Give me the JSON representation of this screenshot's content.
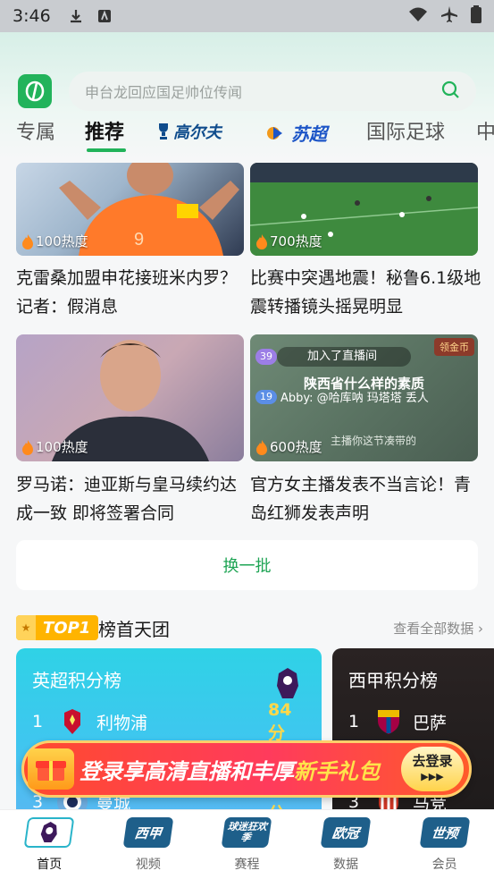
{
  "status_bar": {
    "time": "3:46"
  },
  "header": {
    "search_placeholder": "申台龙回应国足帅位传闻",
    "tabs": [
      {
        "label": "专属"
      },
      {
        "label": "推荐"
      },
      {
        "label": "高尔夫"
      },
      {
        "label": "苏超"
      },
      {
        "label": "国际足球"
      },
      {
        "label": "中"
      }
    ]
  },
  "news": [
    {
      "heat": "100热度",
      "title": "克雷桑加盟申花接班米内罗？记者：假消息"
    },
    {
      "heat": "700热度",
      "title": "比赛中突遇地震！秘鲁6.1级地震转播镜头摇晃明显"
    },
    {
      "heat": "100热度",
      "title": "罗马诺：迪亚斯与皇马续约达成一致 即将签署合同"
    },
    {
      "heat": "600热度",
      "title": "官方女主播发表不当言论！青岛红狮发表声明"
    }
  ],
  "stream_overlay": {
    "tag": "领金币",
    "join_text": "加入了直播间",
    "headline": "陕西省什么样的素质",
    "chat_user": "Abby: @哈库呐 玛塔塔 丢人",
    "chat_line": "主播你这节凑带的",
    "badge_level_1": "39",
    "badge_level_2": "19"
  },
  "refresh_label": "换一批",
  "rank": {
    "badge": "TOP1",
    "title": "榜首天团",
    "see_all": "查看全部数据",
    "boards": [
      {
        "title": "英超积分榜",
        "rows": [
          {
            "no": "1",
            "team": "利物浦",
            "pts": "84分"
          },
          {
            "no": "3",
            "team": "曼城",
            "pts": "71分"
          }
        ]
      },
      {
        "title": "西甲积分榜",
        "rows": [
          {
            "no": "1",
            "team": "巴萨"
          },
          {
            "no": "3",
            "team": "马竞"
          }
        ]
      }
    ]
  },
  "promo": {
    "text_a": "登录享高清直播和丰厚",
    "text_b": "新手礼包",
    "button_line1": "去登录",
    "button_line2": "▶▶▶"
  },
  "bottom_nav": [
    {
      "label": "首页",
      "icon_text": ""
    },
    {
      "label": "视频",
      "icon_text": "西甲"
    },
    {
      "label": "赛程",
      "icon_text": "球迷狂欢季"
    },
    {
      "label": "数据",
      "icon_text": "欧冠"
    },
    {
      "label": "会员",
      "icon_text": "世预"
    }
  ],
  "colors": {
    "accent": "#21b35a",
    "brand_gold": "#ffb400",
    "promo_red": "#ff4b2e"
  }
}
